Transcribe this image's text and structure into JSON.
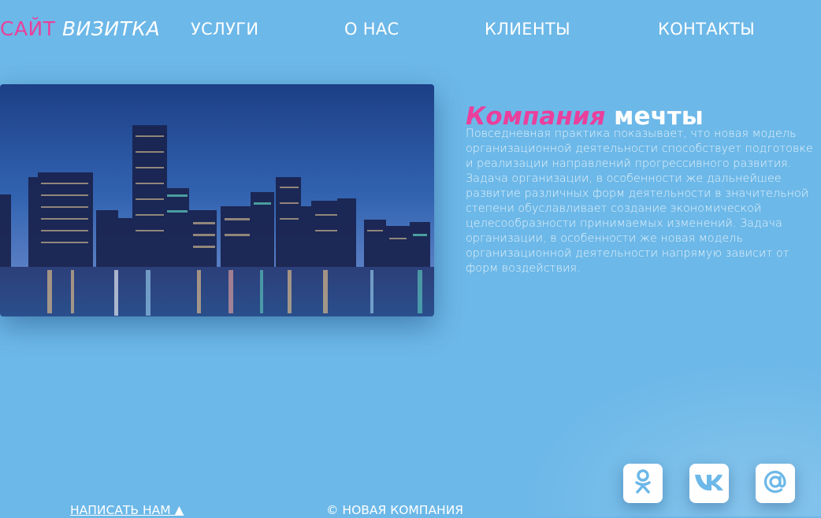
{
  "header": {
    "logo_part1": "САЙТ",
    "logo_part2": "ВИЗИТКА",
    "nav": [
      "УСЛУГИ",
      "О НАС",
      "КЛИЕНТЫ",
      "КОНТАКТЫ"
    ]
  },
  "main": {
    "headline_accent": "Компания",
    "headline_rest": "мечты",
    "description": "Повседневная практика показывает, что новая модель организационной деятельности способствует подготовке и реализации направлений прогрессивного развития. Задача организации, в особенности же дальнейшее развитие различных форм деятельности в значительной степени обуславливает создание экономической целесообразности принимаемых изменений. Задача организации, в особенности же новая модель организационной деятельности напрямую зависит от форм воздействия."
  },
  "footer": {
    "write_us": "НАПИСАТЬ НАМ ▲",
    "copyright": "© НОВАЯ КОМПАНИЯ"
  },
  "social": [
    {
      "icon": "odnoklassniki-icon"
    },
    {
      "icon": "vk-icon"
    },
    {
      "icon": "mail-at-icon"
    }
  ],
  "colors": {
    "background": "#6cb8e8",
    "accent_pink": "#ea3f9c",
    "text_white": "#ffffff",
    "icon_blue": "#6cb8e8"
  }
}
